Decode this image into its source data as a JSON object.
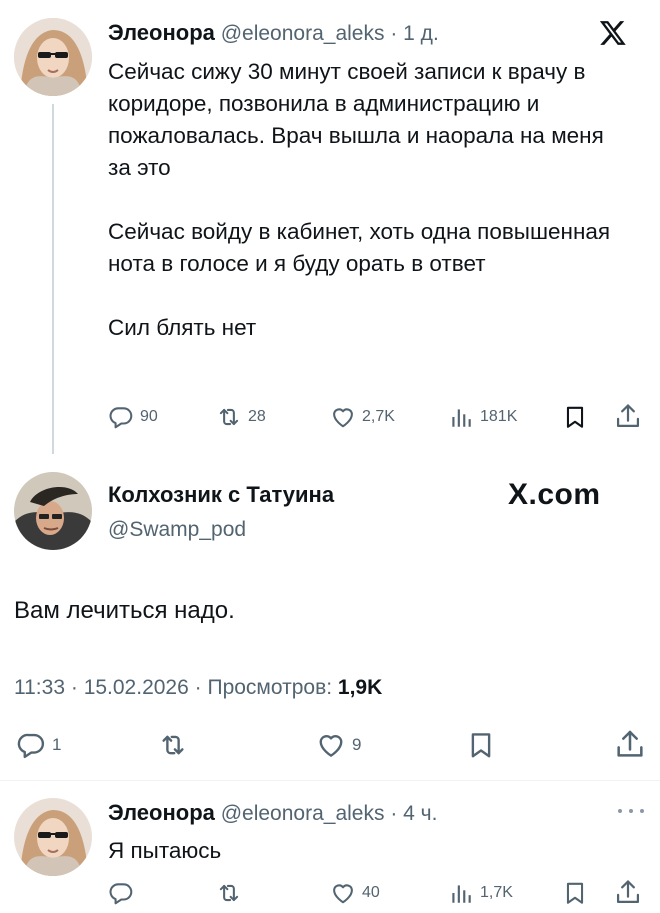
{
  "tweet1": {
    "author_name": "Элеонора",
    "handle": "@eleonora_aleks",
    "separator": "·",
    "time": "1 д.",
    "paragraphs": [
      "Сейчас сижу 30 минут своей записи к врачу в коридоре, позвонила в администрацию и пожаловалась. Врач вышла и наорала на меня за это",
      "Сейчас войду в кабинет, хоть одна повышенная нота в голосе и я буду орать в ответ",
      "Сил блять нет"
    ],
    "replies": "90",
    "reposts": "28",
    "likes": "2,7K",
    "views": "181K"
  },
  "tweet2": {
    "author_name": "Колхозник с Татуина",
    "handle": "@Swamp_pod",
    "brand": "X.com",
    "text": "Вам лечиться надо.",
    "time": "11:33",
    "date": "15.02.2026",
    "sep": "·",
    "views_label": "Просмотров:",
    "views": "1,9K",
    "replies": "1",
    "likes": "9"
  },
  "tweet3": {
    "author_name": "Элеонора",
    "handle": "@eleonora_aleks",
    "separator": "·",
    "time": "4 ч.",
    "text": "Я пытаюсь",
    "likes": "40",
    "views": "1,7K"
  },
  "icons": {
    "reply": "reply-icon",
    "repost": "repost-icon",
    "like": "heart-icon",
    "views": "views-icon",
    "bookmark": "bookmark-icon",
    "share": "share-icon",
    "x_logo": "x-logo-icon",
    "more": "more-icon"
  },
  "colors": {
    "text": "#0f1419",
    "muted": "#536471",
    "line": "#cfd9de"
  }
}
